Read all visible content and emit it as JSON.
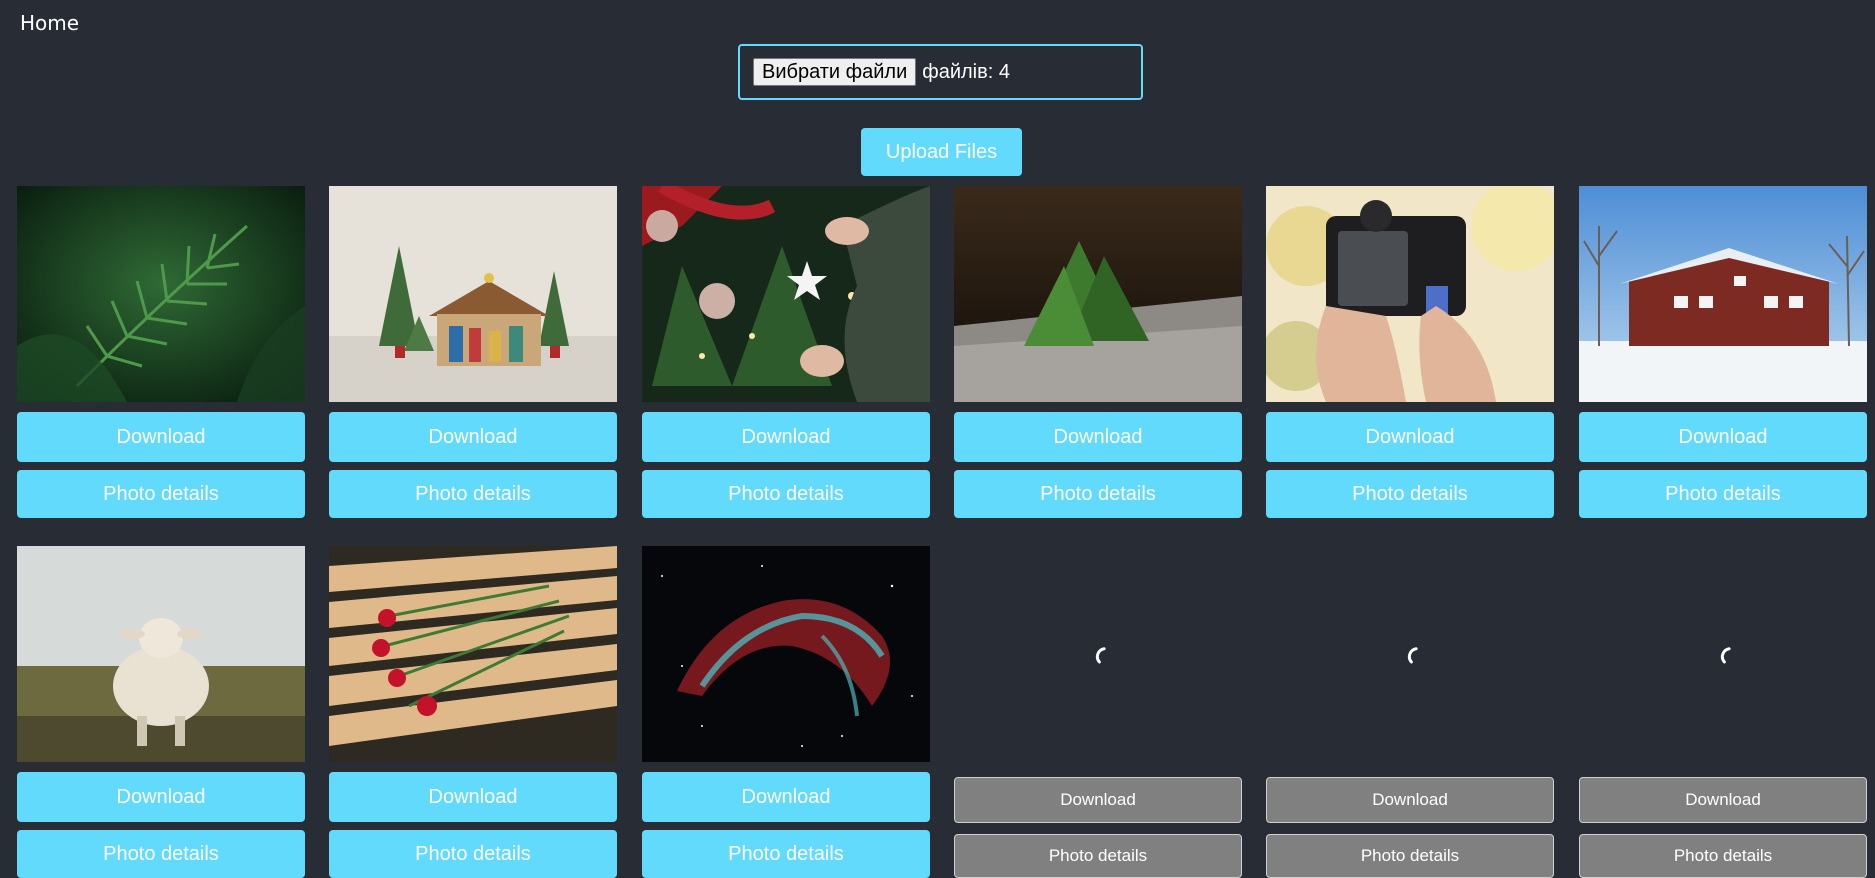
{
  "nav": {
    "home_label": "Home"
  },
  "uploader": {
    "choose_label": "Вибрати файли",
    "selected_text": "файлів: 4",
    "upload_label": "Upload Files"
  },
  "colors": {
    "background": "#282c34",
    "accent": "#61dafb",
    "disabled": "#808080"
  },
  "gallery": {
    "download_label": "Download",
    "details_label": "Photo details",
    "photos": [
      {
        "subject": "fern leaf",
        "status": "loaded"
      },
      {
        "subject": "nativity scene with small trees",
        "status": "loaded"
      },
      {
        "subject": "hanging ornament on christmas tree",
        "status": "loaded"
      },
      {
        "subject": "paper pop-up tree",
        "status": "loaded"
      },
      {
        "subject": "hands holding camera",
        "status": "loaded"
      },
      {
        "subject": "red barn in snow",
        "status": "loaded"
      },
      {
        "subject": "sheep on grass",
        "status": "loaded"
      },
      {
        "subject": "red roses on bench",
        "status": "loaded"
      },
      {
        "subject": "nebula in space",
        "status": "loaded"
      },
      {
        "subject": "",
        "status": "loading"
      },
      {
        "subject": "",
        "status": "loading"
      },
      {
        "subject": "",
        "status": "loading"
      }
    ]
  }
}
